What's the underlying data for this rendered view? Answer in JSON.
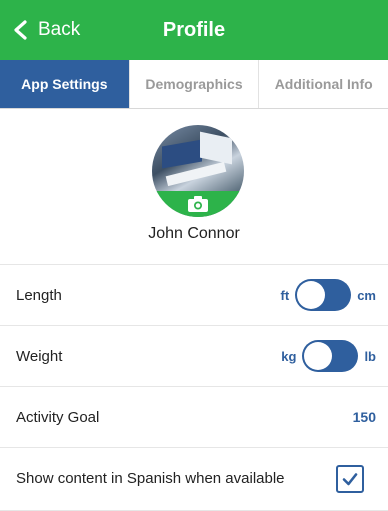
{
  "header": {
    "back_label": "Back",
    "title": "Profile"
  },
  "tabs": [
    {
      "label": "App Settings",
      "active": true
    },
    {
      "label": "Demographics",
      "active": false
    },
    {
      "label": "Additional Info",
      "active": false
    }
  ],
  "profile": {
    "name": "John Connor",
    "avatar_icon": "camera-icon"
  },
  "settings": {
    "length": {
      "label": "Length",
      "left_unit": "ft",
      "right_unit": "cm",
      "selected_unit": "ft"
    },
    "weight": {
      "label": "Weight",
      "left_unit": "kg",
      "right_unit": "lb",
      "selected_unit": "kg"
    },
    "activity_goal": {
      "label": "Activity Goal",
      "value": "150"
    },
    "spanish": {
      "label": "Show content in Spanish when available",
      "checked": true
    }
  },
  "colors": {
    "header_green": "#2db34a",
    "accent_blue": "#2f5f9e"
  }
}
